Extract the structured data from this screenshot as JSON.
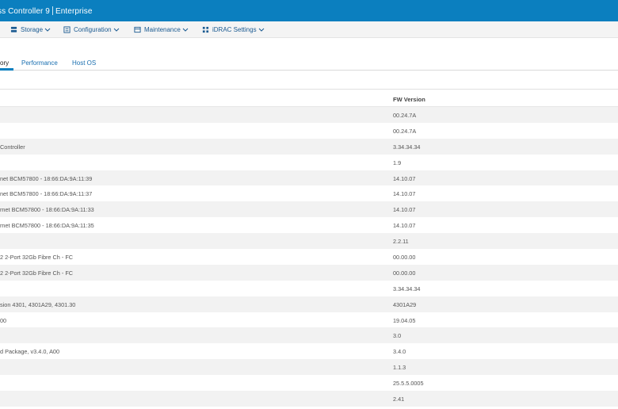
{
  "header": {
    "title_left": "ss Controller 9",
    "title_right": "Enterprise"
  },
  "menu": [
    {
      "label": "Storage",
      "icon": "storage-icon"
    },
    {
      "label": "Configuration",
      "icon": "configuration-icon"
    },
    {
      "label": "Maintenance",
      "icon": "maintenance-icon"
    },
    {
      "label": "iDRAC Settings",
      "icon": "idrac-settings-icon"
    }
  ],
  "tabs": [
    {
      "label": "ory",
      "active": true
    },
    {
      "label": "Performance",
      "active": false
    },
    {
      "label": "Host OS",
      "active": false
    }
  ],
  "table": {
    "fw_header": "FW Version",
    "rows": [
      {
        "name": "",
        "fw": "00.24.7A"
      },
      {
        "name": "",
        "fw": "00.24.7A"
      },
      {
        "name": "Controller",
        "fw": "3.34.34.34"
      },
      {
        "name": "",
        "fw": "1.9"
      },
      {
        "name": "net BCM57800 - 18:66:DA:9A:11:39",
        "fw": "14.10.07"
      },
      {
        "name": "net BCM57800 - 18:66:DA:9A:11:37",
        "fw": "14.10.07"
      },
      {
        "name": "rnet BCM57800 - 18:66:DA:9A:11:33",
        "fw": "14.10.07"
      },
      {
        "name": "rnet BCM57800 - 18:66:DA:9A:11:35",
        "fw": "14.10.07"
      },
      {
        "name": "",
        "fw": "2.2.11"
      },
      {
        "name": "2 2-Port 32Gb Fibre Ch - FC",
        "fw": "00.00.00"
      },
      {
        "name": "2 2-Port 32Gb Fibre Ch - FC",
        "fw": "00.00.00"
      },
      {
        "name": "",
        "fw": "3.34.34.34"
      },
      {
        "name": "sion 4301, 4301A29, 4301.30",
        "fw": "4301A29"
      },
      {
        "name": "00",
        "fw": "19.04.05"
      },
      {
        "name": "",
        "fw": "3.0"
      },
      {
        "name": "d Package, v3.4.0, A00",
        "fw": "3.4.0"
      },
      {
        "name": "",
        "fw": "1.1.3"
      },
      {
        "name": "",
        "fw": "25.5.5.0005"
      },
      {
        "name": "",
        "fw": "2.41"
      }
    ]
  },
  "colors": {
    "brand": "#0b7fbf",
    "link": "#1a6fb0"
  }
}
